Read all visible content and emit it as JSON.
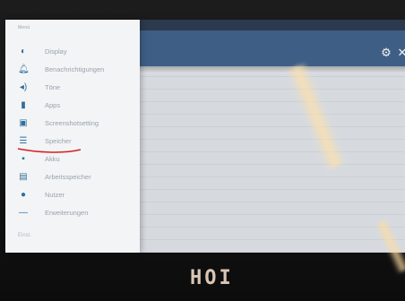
{
  "drawer": {
    "header": "Menü",
    "items": [
      {
        "label": "Display",
        "icon": "brightness-icon"
      },
      {
        "label": "Benachrichtigungen",
        "icon": "bell-icon"
      },
      {
        "label": "Töne",
        "icon": "speaker-icon"
      },
      {
        "label": "Apps",
        "icon": "apps-icon"
      },
      {
        "label": "Screenshotsetting",
        "icon": "image-icon"
      },
      {
        "label": "Speicher",
        "icon": "storage-icon"
      },
      {
        "label": "Akku",
        "icon": "battery-icon"
      },
      {
        "label": "Arbeitsspeicher",
        "icon": "memory-icon"
      },
      {
        "label": "Nutzer",
        "icon": "user-icon"
      },
      {
        "label": "Erweiterungen",
        "icon": "extension-icon"
      }
    ],
    "footer": "Einst."
  },
  "appbar": {
    "settings_glyph": "⚙",
    "close_glyph": "✕"
  },
  "device": {
    "brand": "HOI"
  },
  "colors": {
    "appbar": "#3f5e85",
    "drawer_bg": "#f3f4f6",
    "icon_accent": "#2f6f9f",
    "annotation": "#d61f1f"
  }
}
